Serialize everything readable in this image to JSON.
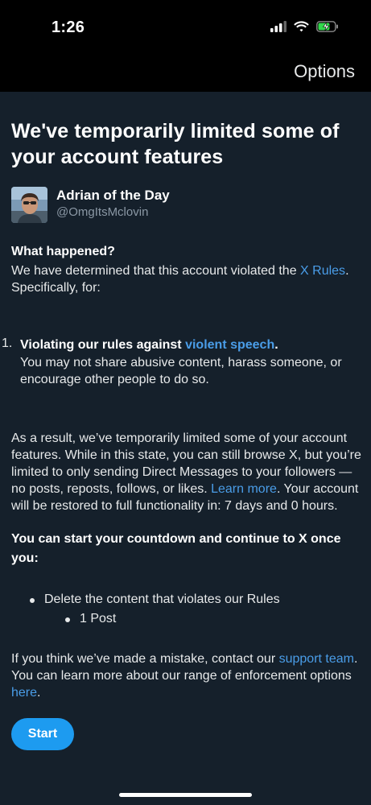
{
  "status": {
    "time": "1:26"
  },
  "nav": {
    "options_label": "Options"
  },
  "title": "We've temporarily limited some of your account features",
  "account": {
    "name": "Adrian of the Day",
    "handle": "@OmgItsMclovin"
  },
  "what_happened": {
    "heading": "What happened?",
    "text_before": "We have determined that this account violated the ",
    "link": "X Rules",
    "text_after": ". Specifically, for:"
  },
  "violation": {
    "number": "1.",
    "title_before": "Violating our rules against ",
    "title_link": "violent speech",
    "title_after": ".",
    "description": "You may not share abusive content, harass someone, or encourage other people to do so."
  },
  "result": {
    "text_before": "As a result, we’ve temporarily limited some of your account features. While in this state, you can still browse X, but you’re limited to only sending Direct Messages to your followers — no posts, reposts, follows, or likes. ",
    "link": "Learn more",
    "text_after": ". Your account will be restored to full functionality in: 7 days and 0 hours."
  },
  "countdown_heading": "You can start your countdown and continue to X once you:",
  "requirements": {
    "item": "Delete the content that violates our Rules",
    "sub_item": "1 Post"
  },
  "mistake": {
    "text_before": "If you think we’ve made a mistake, contact our ",
    "link1": "support team",
    "text_middle": ". You can learn more about our range of enforcement options ",
    "link2": "here",
    "text_after": "."
  },
  "start_label": "Start",
  "colors": {
    "background": "#15202b",
    "link": "#4a9de8",
    "button": "#1d9bf0",
    "muted": "#8b98a5"
  }
}
